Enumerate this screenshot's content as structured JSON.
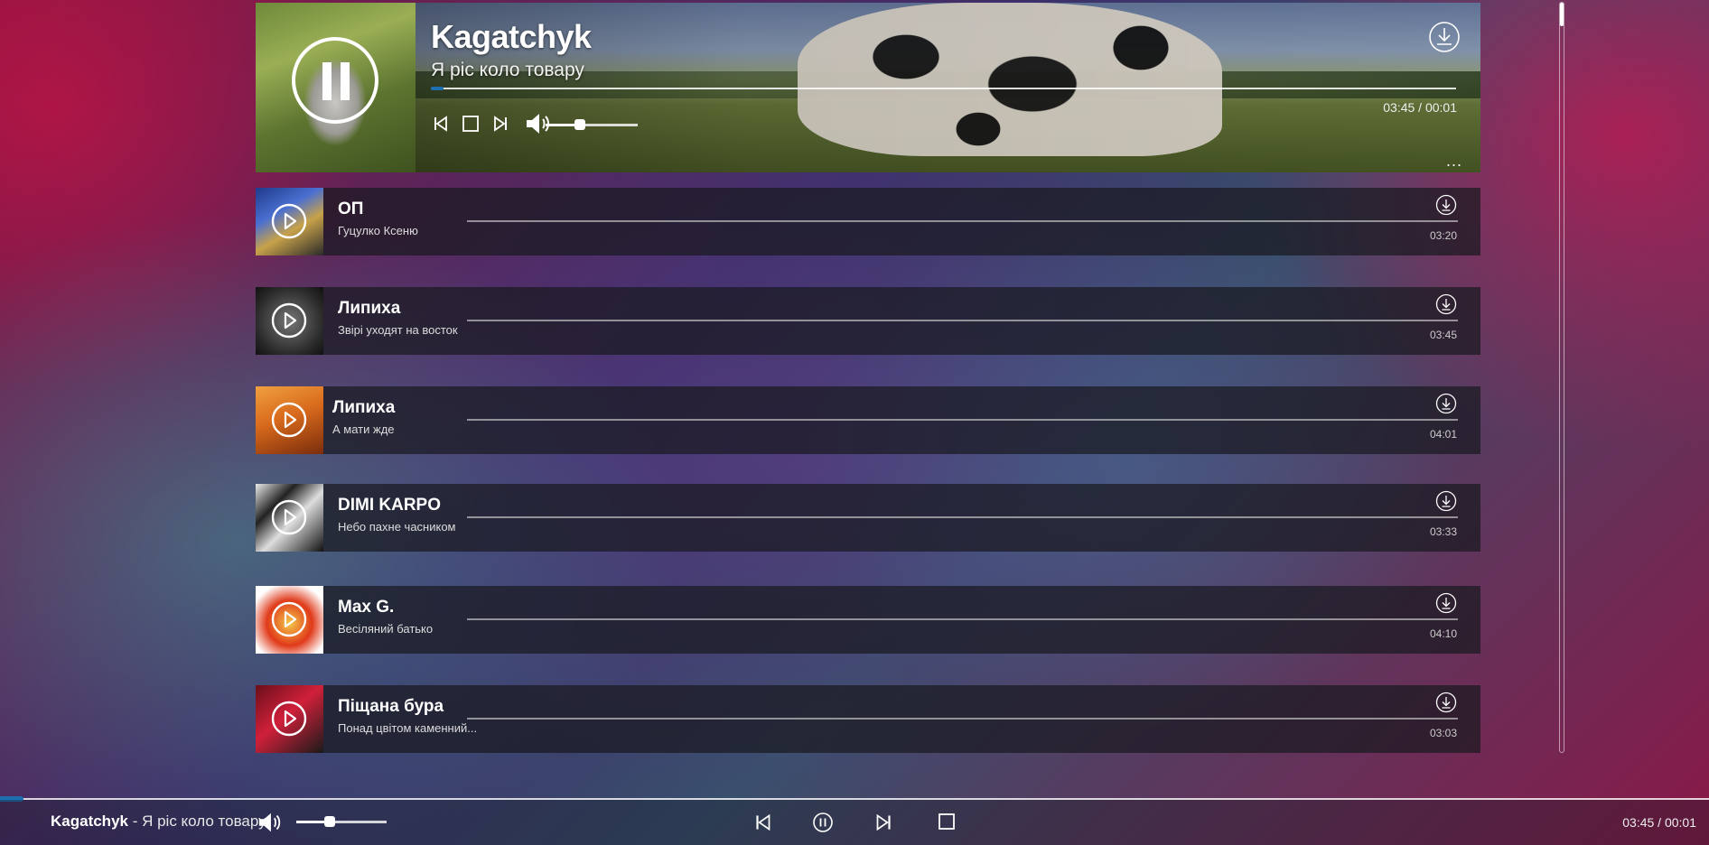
{
  "now_playing": {
    "artist": "Kagatchyk",
    "title": "Я ріс коло товару",
    "time": "03:45 / 00:01",
    "progress": 0.012,
    "volume": 0.37,
    "more_label": "..."
  },
  "tracks": [
    {
      "artist": "ОП",
      "title": "Гуцулко Ксеню",
      "duration": "03:20"
    },
    {
      "artist": "Липиха",
      "title": "Звірі уходят на восток",
      "duration": "03:45"
    },
    {
      "artist": "Липиха",
      "title": "А мати жде",
      "duration": "04:01"
    },
    {
      "artist": "DIMI KARPO",
      "title": "Небо пахне часником",
      "duration": "03:33"
    },
    {
      "artist": "Max G.",
      "title": "Весіляний батько",
      "duration": "04:10"
    },
    {
      "artist": "Піщана бура",
      "title": "Понад цвітом каменний...",
      "duration": "03:03"
    }
  ],
  "bottom_bar": {
    "artist": "Kagatchyk",
    "separator": " - ",
    "title": "Я ріс коло товару",
    "time": "03:45 / 00:01",
    "progress": 0.014,
    "volume": 0.37
  },
  "colors": {
    "accent": "#1e6fb0",
    "row_background": "#19191f"
  },
  "icons": {
    "download": "download-circle-icon",
    "play": "play-circle-icon",
    "pause": "pause-circle-icon",
    "previous": "skip-previous-icon",
    "next": "skip-next-icon",
    "stop": "stop-icon",
    "volume": "volume-icon"
  }
}
